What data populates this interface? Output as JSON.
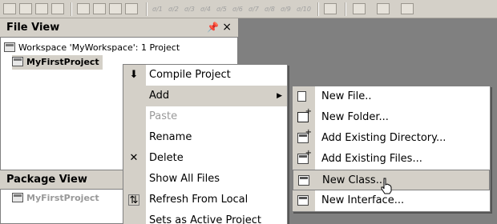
{
  "file_view": {
    "title": "File View",
    "pin_glyph": "q",
    "close_glyph": "×",
    "workspace_label": "Workspace 'MyWorkspace': 1 Project",
    "project_label": "MyFirstProject"
  },
  "package_view": {
    "title": "Package View",
    "project_label": "MyFirstProject"
  },
  "toolbar": {
    "bookmarks": [
      "σ/1",
      "σ/2",
      "σ/3",
      "σ/4",
      "σ/5",
      "σ/6",
      "σ/7",
      "σ/8",
      "σ/9",
      "σ/10"
    ]
  },
  "context_menu": {
    "items": [
      {
        "label": "Compile Project",
        "icon": "compile-icon",
        "glyph": "⬇"
      },
      {
        "label": "Add",
        "icon": "",
        "glyph": "",
        "submenu_glyph": "▶"
      },
      {
        "label": "Paste",
        "icon": "",
        "glyph": ""
      },
      {
        "label": "Rename",
        "icon": "",
        "glyph": ""
      },
      {
        "label": "Delete",
        "icon": "delete-icon",
        "glyph": "✕"
      },
      {
        "label": "Show All Files",
        "icon": "",
        "glyph": ""
      },
      {
        "label": "Refresh From Local",
        "icon": "refresh-icon",
        "glyph": "⇅"
      },
      {
        "label": "Sets as Active Project",
        "icon": "",
        "glyph": ""
      }
    ]
  },
  "submenu": {
    "items": [
      {
        "label": "New File..",
        "icon": "new-file-icon"
      },
      {
        "label": "New Folder...",
        "icon": "new-folder-icon"
      },
      {
        "label": "Add Existing Directory...",
        "icon": "add-directory-icon"
      },
      {
        "label": "Add Existing Files...",
        "icon": "add-files-icon"
      },
      {
        "label": "New Class...",
        "icon": "new-class-icon"
      },
      {
        "label": "New Interface...",
        "icon": "new-interface-icon"
      }
    ]
  },
  "colors": {
    "background": "#808080",
    "panel": "#d4d0c8",
    "menu_bg": "#ffffff",
    "highlight": "#d4d0c8"
  }
}
